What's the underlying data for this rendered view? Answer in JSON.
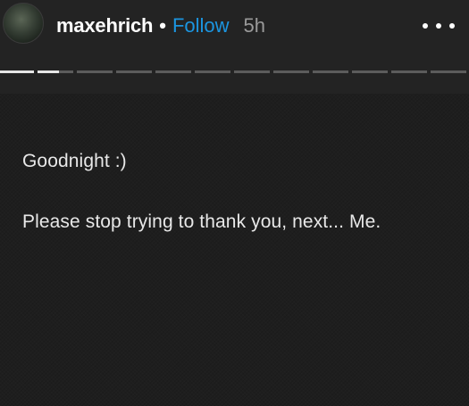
{
  "header": {
    "username": "maxehrich",
    "separator": "•",
    "follow_label": "Follow",
    "timestamp": "5h",
    "more_icon": "more-horizontal-icon"
  },
  "progress": {
    "segments_total": 12,
    "segments_completed": 1,
    "current_segment_progress": 0.6
  },
  "post": {
    "lines": [
      "Goodnight :)",
      "Please stop trying to thank you, next... Me."
    ]
  },
  "colors": {
    "background": "#1e1e1e",
    "header_background": "#232323",
    "follow_accent": "#1b95e0",
    "timestamp": "#9a9a9a",
    "text": "#e8e8e8"
  }
}
